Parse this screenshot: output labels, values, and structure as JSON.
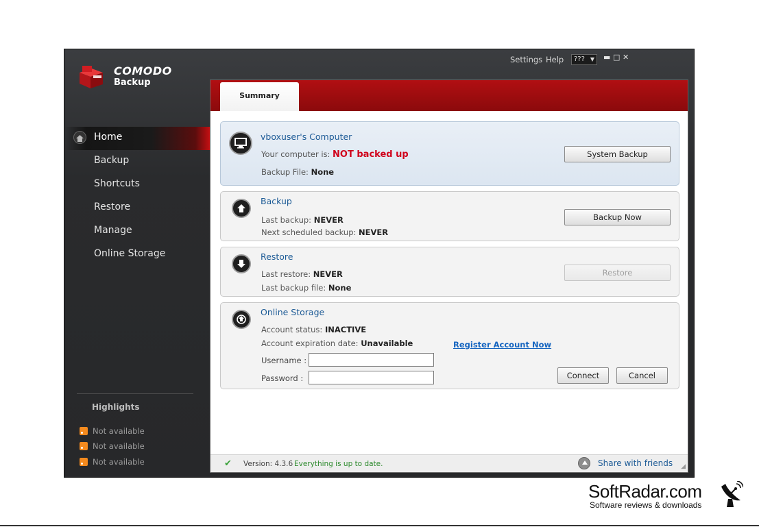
{
  "titlebar": {
    "settings": "Settings",
    "help": "Help",
    "language": "???",
    "minimize": "▬",
    "maximize": "□",
    "close": "✕"
  },
  "logo": {
    "brand": "COMODO",
    "product": "Backup"
  },
  "sidebar": {
    "items": [
      {
        "label": "Home"
      },
      {
        "label": "Backup"
      },
      {
        "label": "Shortcuts"
      },
      {
        "label": "Restore"
      },
      {
        "label": "Manage"
      },
      {
        "label": "Online Storage"
      }
    ],
    "highlights_title": "Highlights",
    "highlights": [
      "Not available",
      "Not available",
      "Not available"
    ]
  },
  "tab": {
    "label": "Summary"
  },
  "computer": {
    "title": "vboxuser's Computer",
    "status_label": "Your computer is:",
    "status_value": "NOT backed up",
    "file_label": "Backup File:",
    "file_value": "None",
    "button": "System Backup"
  },
  "backup": {
    "title": "Backup",
    "last_label": "Last backup:",
    "last_value": "NEVER",
    "next_label": "Next scheduled backup:",
    "next_value": "NEVER",
    "button": "Backup Now"
  },
  "restore": {
    "title": "Restore",
    "last_label": "Last restore:",
    "last_value": "NEVER",
    "file_label": "Last backup file:",
    "file_value": "None",
    "button": "Restore"
  },
  "online": {
    "title": "Online Storage",
    "status_label": "Account status:",
    "status_value": "INACTIVE",
    "expiry_label": "Account expiration date:",
    "expiry_value": "Unavailable",
    "register_link": "Register Account Now",
    "username_label": "Username :",
    "password_label": "Password :",
    "username_value": "",
    "password_value": "",
    "connect_button": "Connect",
    "cancel_button": "Cancel"
  },
  "statusbar": {
    "version": "Version:  4.3.6",
    "uptodate": "Everything is up to date.",
    "share": "Share with friends"
  },
  "watermark": {
    "name": "SoftRadar.com",
    "tagline": "Software reviews & downloads"
  },
  "colors": {
    "accent_red": "#b10f12",
    "link_blue": "#1d5b96",
    "alert_red": "#d0021b",
    "ok_green": "#2e8b2e"
  }
}
